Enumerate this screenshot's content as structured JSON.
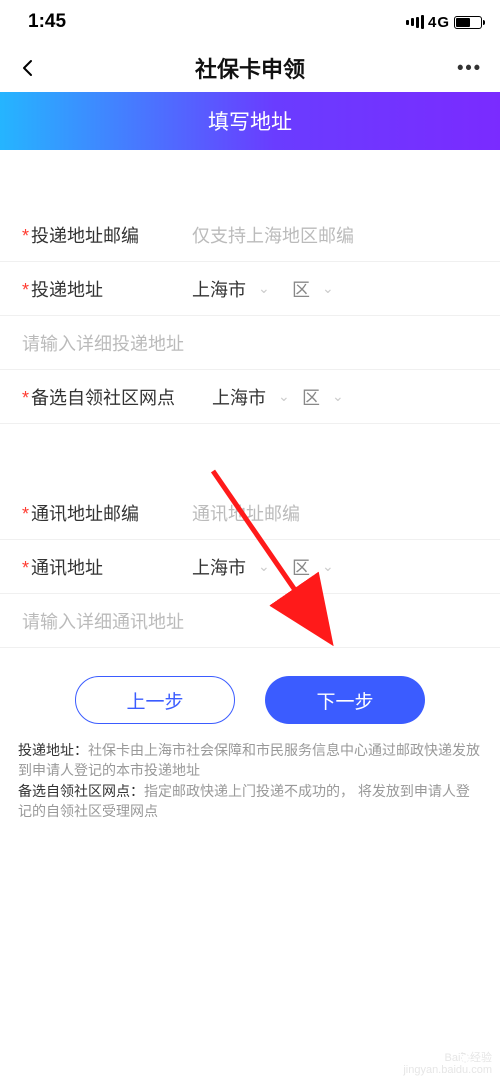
{
  "status": {
    "time": "1:45",
    "network": "4G"
  },
  "nav": {
    "title": "社保卡申领",
    "more": "•••"
  },
  "banner": {
    "title": "填写地址"
  },
  "form": {
    "delivery_postcode": {
      "label": "投递地址邮编",
      "placeholder": "仅支持上海地区邮编"
    },
    "delivery_addr": {
      "label": "投递地址",
      "city": "上海市",
      "district": "区"
    },
    "delivery_detail_placeholder": "请输入详细投递地址",
    "pickup_point": {
      "label": "备选自领社区网点",
      "city": "上海市",
      "district": "区"
    },
    "contact_postcode": {
      "label": "通讯地址邮编",
      "placeholder": "通讯地址邮编"
    },
    "contact_addr": {
      "label": "通讯地址",
      "city": "上海市",
      "district": "区"
    },
    "contact_detail_placeholder": "请输入详细通讯地址"
  },
  "buttons": {
    "prev": "上一步",
    "next": "下一步"
  },
  "notes": {
    "n1_label": "投递地址：",
    "n1_text": "社保卡由上海市社会保障和市民服务信息中心通过邮政快递发放到申请人登记的本市投递地址",
    "n2_label": "备选自领社区网点：",
    "n2_text": "指定邮政快递上门投递不成功的，   将发放到申请人登记的自领社区受理网点"
  },
  "watermark": {
    "l1": "Bai߱经验",
    "l2": "jingyan.baidu.com"
  }
}
